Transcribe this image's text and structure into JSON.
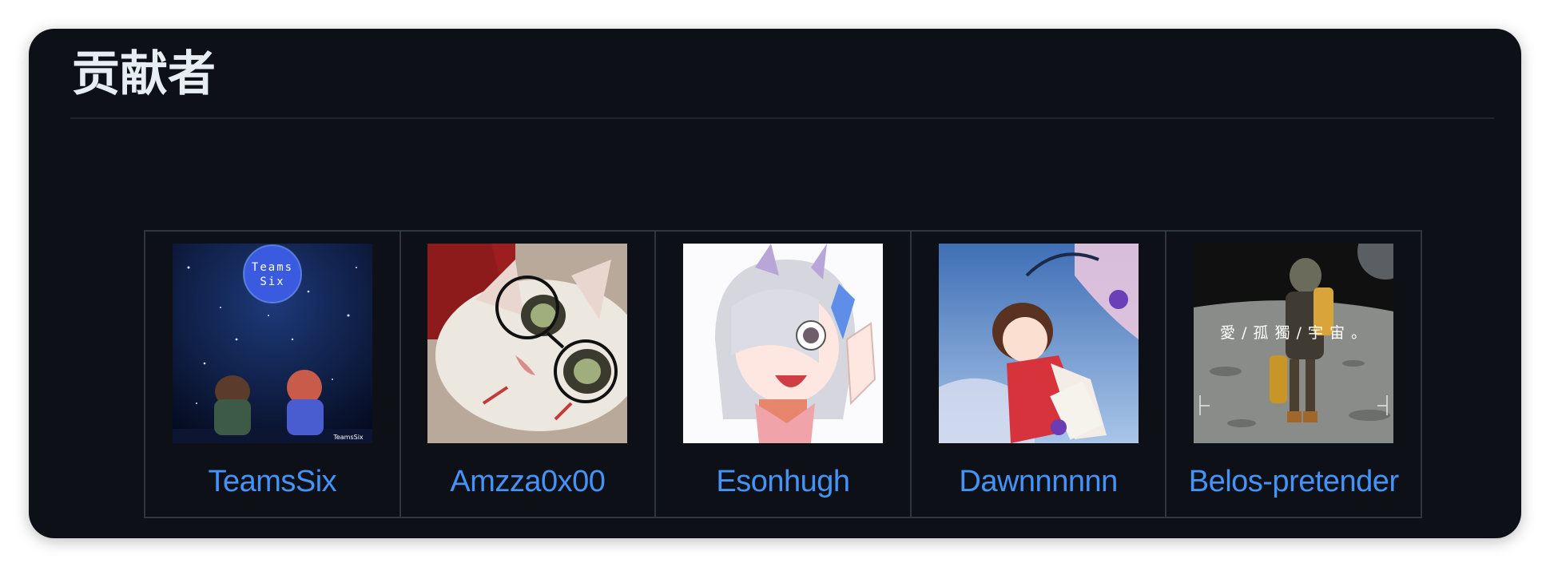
{
  "section": {
    "title": "贡献者"
  },
  "theme": {
    "background": "#0d1117",
    "link": "#4493f8",
    "border": "#30363d"
  },
  "contributors": [
    {
      "name": "TeamsSix",
      "avatar_icon": "night-sky-avatar-icon",
      "avatar_badge": "Teams\nSix",
      "avatar_badge_line1": "Teams",
      "avatar_badge_line2": "Six",
      "avatar_watermark": "TeamsSix"
    },
    {
      "name": "Amzza0x00",
      "avatar_icon": "cat-with-glasses-avatar-icon"
    },
    {
      "name": "Esonhugh",
      "avatar_icon": "anime-fox-girl-avatar-icon"
    },
    {
      "name": "Dawnnnnnn",
      "avatar_icon": "anime-girl-blue-sky-avatar-icon"
    },
    {
      "name": "Belos-pretender",
      "avatar_icon": "astronaut-moon-avatar-icon",
      "avatar_caption": "愛 / 孤 獨 / 宇 宙 。"
    }
  ]
}
